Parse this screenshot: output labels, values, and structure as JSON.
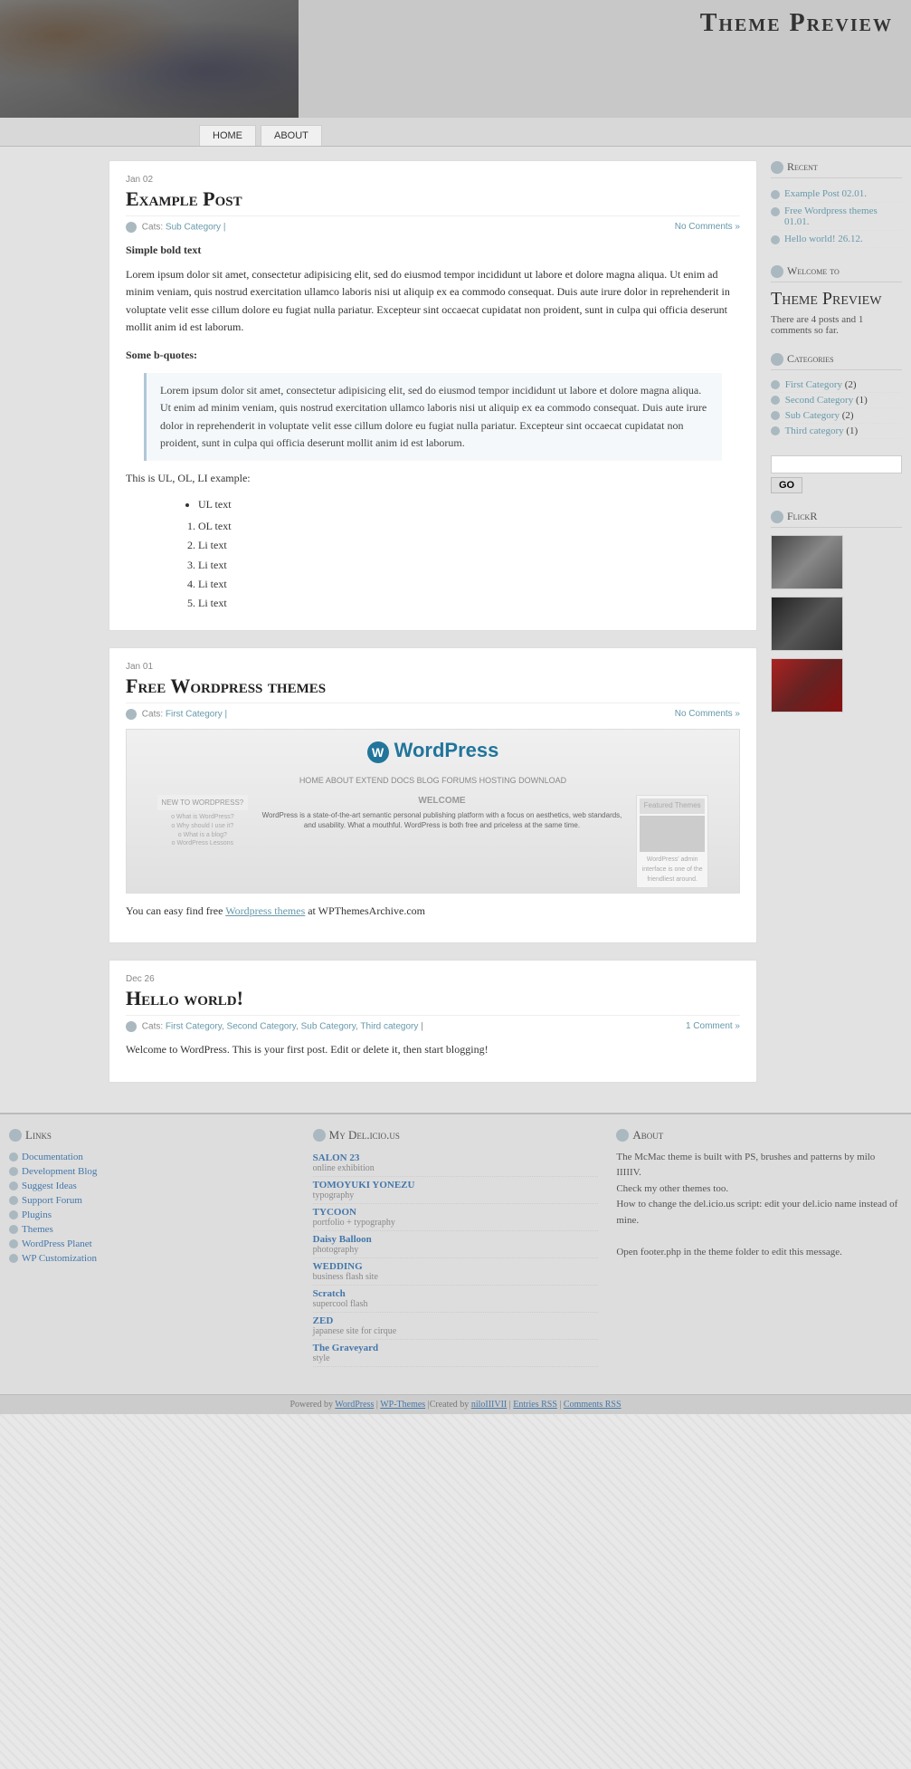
{
  "header": {
    "title": "Theme Preview"
  },
  "nav": {
    "items": [
      {
        "label": "HOME",
        "href": "#"
      },
      {
        "label": "ABOUT",
        "href": "#"
      }
    ]
  },
  "posts": [
    {
      "id": "example-post",
      "date": "Jan 02",
      "title": "Example Post",
      "cats_label": "Cats:",
      "cats": "Sub Category |",
      "comments": "No Comments »",
      "bold_text": "Simple bold text",
      "body_p1": "Lorem ipsum dolor sit amet, consectetur adipisicing elit, sed do eiusmod tempor incididunt ut labore et dolore magna aliqua. Ut enim ad minim veniam, quis nostrud exercitation ullamco laboris nisi ut aliquip ex ea commodo consequat. Duis aute irure dolor in reprehenderit in voluptate velit esse cillum dolore eu fugiat nulla pariatur. Excepteur sint occaecat cupidatat non proident, sunt in culpa qui officia deserunt mollit anim id est laborum.",
      "blockquote_label": "Some b-quotes:",
      "blockquote_text": "Lorem ipsum dolor sit amet, consectetur adipisicing elit, sed do eiusmod tempor incididunt ut labore et dolore magna aliqua. Ut enim ad minim veniam, quis nostrud exercitation ullamco laboris nisi ut aliquip ex ea commodo consequat. Duis aute irure dolor in reprehenderit in voluptate velit esse cillum dolore eu fugiat nulla pariatur. Excepteur sint occaecat cupidatat non proident, sunt in culpa qui officia deserunt mollit anim id est laborum.",
      "list_label": "This is UL, OL, LI example:",
      "ul_item": "UL text",
      "ol_item": "OL text",
      "li_items": [
        "Li text",
        "Li text",
        "Li text",
        "Li text"
      ]
    },
    {
      "id": "free-wordpress-themes",
      "date": "Jan 01",
      "title": "Free Wordpress themes",
      "cats_label": "Cats:",
      "cats": "First Category |",
      "comments": "No Comments »",
      "wp_text_before": "You can easy find free",
      "wp_link_text": "Wordpress themes",
      "wp_text_after": "at WPThemesArchive.com"
    },
    {
      "id": "hello-world",
      "date": "Dec 26",
      "title": "Hello world!",
      "cats_label": "Cats:",
      "cats": "First Category, Second Category, Sub Category, Third category |",
      "comments": "1 Comment »",
      "body": "Welcome to WordPress. This is your first post. Edit or delete it, then start blogging!"
    }
  ],
  "sidebar_right": {
    "recent_title": "Recent",
    "recent_posts": [
      {
        "title": "Example Post 02.01.",
        "href": "#"
      },
      {
        "title": "Free Wordpress themes 01.01.",
        "href": "#"
      },
      {
        "title": "Hello world! 26.12.",
        "href": "#"
      }
    ],
    "categories_title": "Categories",
    "categories": [
      {
        "name": "First Category",
        "count": "(2)"
      },
      {
        "name": "Second Category",
        "count": "(1)"
      },
      {
        "name": "Sub Category",
        "count": "(2)"
      },
      {
        "name": "Third category",
        "count": "(1)"
      }
    ],
    "search_placeholder": "",
    "search_button": "GO",
    "welcome_title": "Welcome to",
    "welcome_heading": "Theme Preview",
    "welcome_text": "There are 4 posts and 1 comments so far.",
    "flickr_title": "FlickR"
  },
  "footer": {
    "links_title": "Links",
    "links": [
      "Documentation",
      "Development Blog",
      "Suggest Ideas",
      "Support Forum",
      "Plugins",
      "Themes",
      "WordPress Planet",
      "WP Customization"
    ],
    "delicious_title": "My Del.icio.us",
    "delicious_items": [
      {
        "title": "SALON 23",
        "sub": "online exhibition"
      },
      {
        "title": "TOMOYUKI YONEZU",
        "sub": "typography"
      },
      {
        "title": "TYCOON",
        "sub": "portfolio + typography"
      },
      {
        "title": "Daisy Balloon",
        "sub": "photography"
      },
      {
        "title": "WEDDING",
        "sub": "business flash site"
      },
      {
        "title": "Scratch",
        "sub": "supercool flash"
      },
      {
        "title": "ZED",
        "sub": "japanese site for cirque"
      },
      {
        "title": "The Graveyard",
        "sub": "style"
      }
    ],
    "about_title": "About",
    "about_text": "The McMac theme is built with PS, brushes and patterns by milo IIIIIV.\nCheck my other themes too.\nHow to change the del.icio.us script: edit your del.icio name instead of mine.\n\nOpen footer.php in the theme folder to edit this message.",
    "bar_text": "Powered by",
    "bar_wordpress": "WordPress",
    "bar_wpthemes": "WP-Themes",
    "bar_created": "|Created by",
    "bar_author": "niloIIIVII",
    "bar_entries": "Entries RSS",
    "bar_comments": "Comments RSS"
  },
  "wordpress_mockup": {
    "logo": "WordPress",
    "nav": "HOME  ABOUT  EXTEND  DOCS  BLOG  FORUMS  HOSTING  DOWNLOAD",
    "welcome_title": "WELCOME",
    "welcome_text": "WordPress is a state-of-the-art semantic personal publishing platform with a focus on aesthetics, web standards, and usability. What a mouthful. WordPress is both free and priceless at the same time.",
    "footer_note": "WordPress' admin interface is one of the friendliest around."
  }
}
